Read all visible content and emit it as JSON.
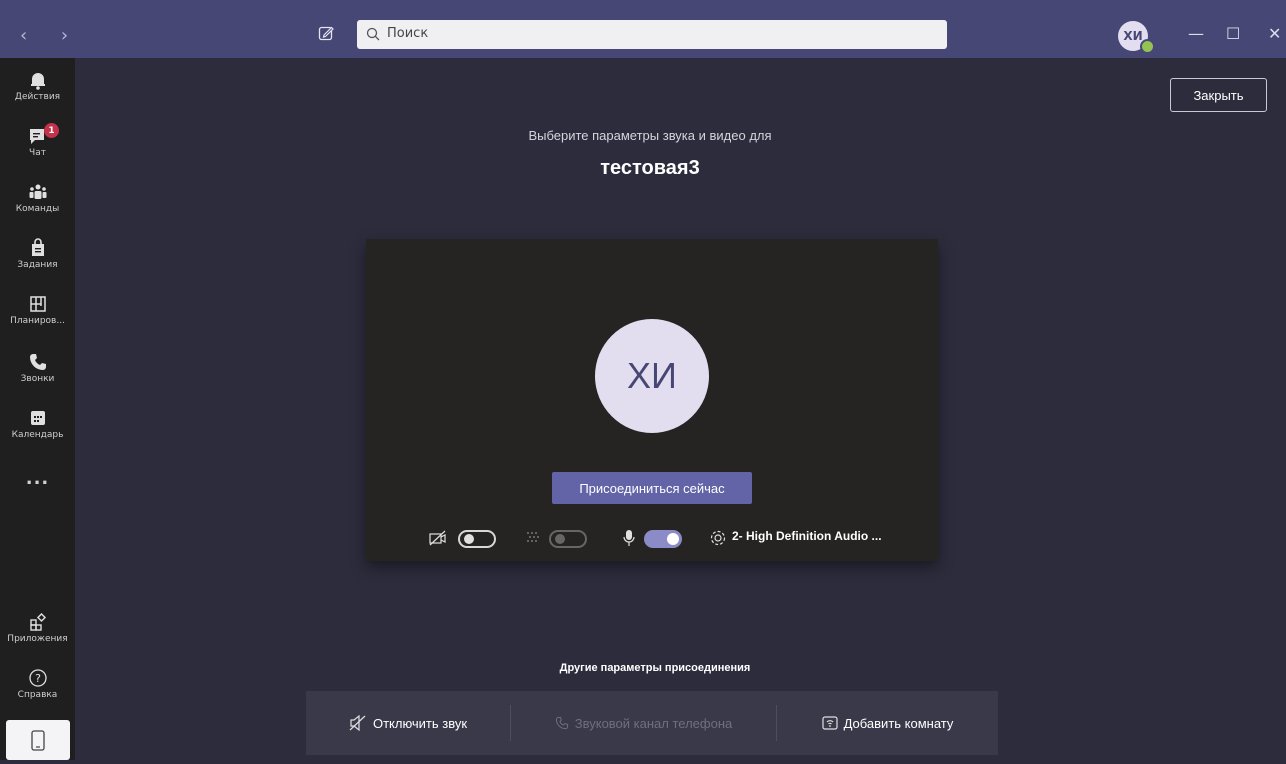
{
  "titlebar": {
    "search_placeholder": "Поиск",
    "user_initials": "ХИ"
  },
  "rail": {
    "items": [
      {
        "label": "Действия",
        "icon": "bell-icon"
      },
      {
        "label": "Чат",
        "icon": "chat-icon",
        "badge": "1"
      },
      {
        "label": "Команды",
        "icon": "teams-icon"
      },
      {
        "label": "Задания",
        "icon": "assignments-icon"
      },
      {
        "label": "Планиров...",
        "icon": "planner-icon"
      },
      {
        "label": "Звонки",
        "icon": "phone-icon"
      },
      {
        "label": "Календарь",
        "icon": "calendar-icon"
      },
      {
        "label": "...",
        "icon": "more-icon"
      },
      {
        "label": "Приложения",
        "icon": "apps-icon"
      },
      {
        "label": "Справка",
        "icon": "help-icon"
      }
    ]
  },
  "close_label": "Закрыть",
  "prejoin": {
    "subtitle": "Выберите параметры звука и видео для",
    "meeting_name": "тестовая3",
    "avatar_initials": "ХИ",
    "join_label": "Присоединиться сейчас",
    "camera_on": false,
    "blur_on": false,
    "mic_on": true,
    "audio_device": "2- High Definition Audio ..."
  },
  "other_options": {
    "title": "Другие параметры присоединения",
    "mute_label": "Отключить звук",
    "phone_label": "Звуковой канал телефона",
    "room_label": "Добавить комнату"
  },
  "colors": {
    "titlebar": "#464775",
    "accent": "#6264a7",
    "background": "#2d2c3d"
  }
}
